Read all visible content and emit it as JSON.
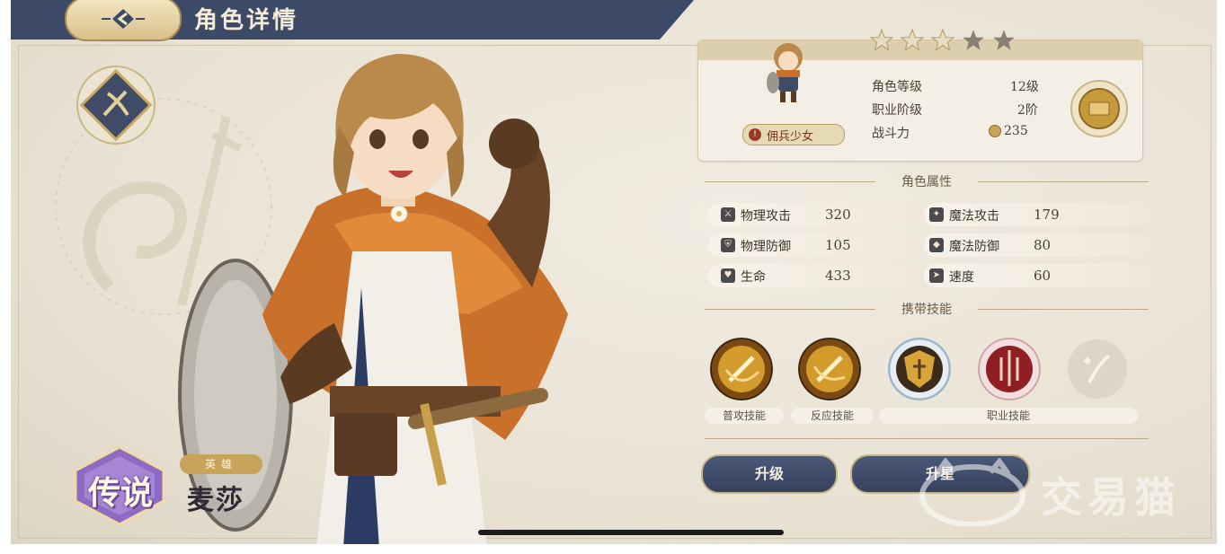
{
  "header": {
    "title": "角色详情"
  },
  "hero": {
    "rarity": "传说",
    "title": "英雄",
    "name": "麦莎",
    "job": "佣兵少女",
    "stars_filled": 3,
    "stars_total": 5
  },
  "info": {
    "stats": [
      {
        "label": "角色等级",
        "value": "12级"
      },
      {
        "label": "职业阶级",
        "value": "2阶"
      },
      {
        "label": "战斗力",
        "value": "235"
      }
    ]
  },
  "attributes": {
    "title": "角色属性",
    "rows": [
      {
        "left": {
          "label": "物理攻击",
          "value": "320"
        },
        "right": {
          "label": "魔法攻击",
          "value": "179"
        }
      },
      {
        "left": {
          "label": "物理防御",
          "value": "105"
        },
        "right": {
          "label": "魔法防御",
          "value": "80"
        }
      },
      {
        "left": {
          "label": "生命",
          "value": "433"
        },
        "right": {
          "label": "速度",
          "value": "60"
        }
      }
    ]
  },
  "skills": {
    "title": "携带技能",
    "labels": {
      "normal": "普攻技能",
      "reaction": "反应技能",
      "job": "职业技能"
    }
  },
  "buttons": {
    "level_up": "升级",
    "star_up": "升星"
  },
  "watermark": {
    "text": "交易猫"
  },
  "colors": {
    "header": "#3c4a68",
    "gold": "#c8a35a",
    "button": "#3e4a68",
    "background": "#ebe5d8"
  }
}
